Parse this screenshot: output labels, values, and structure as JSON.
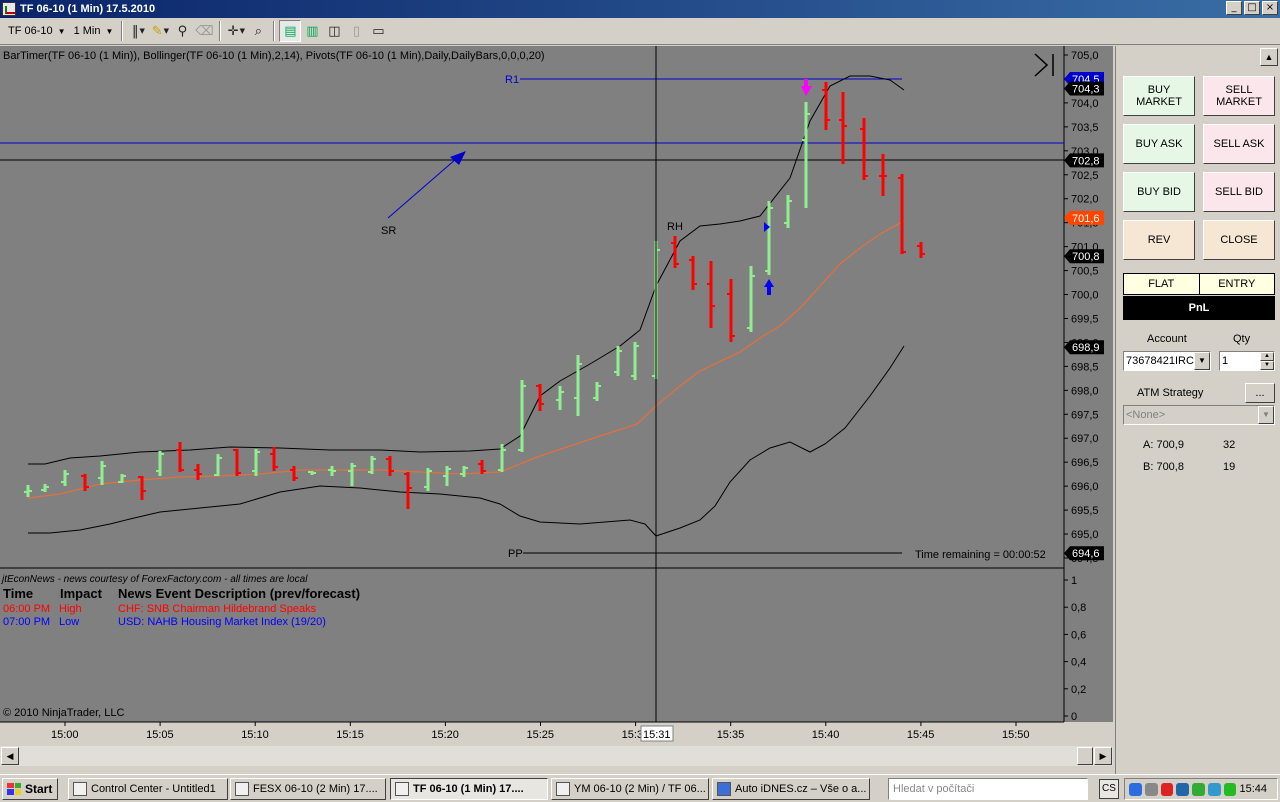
{
  "window": {
    "title": "TF 06-10 (1 Min)  17.5.2010",
    "buttons": [
      "_",
      "□",
      "×"
    ]
  },
  "toolbar": {
    "instrument": "TF 06-10",
    "interval": "1 Min"
  },
  "chart": {
    "indicators_label": "BarTimer(TF 06-10 (1 Min)), Bollinger(TF 06-10 (1 Min),2,14), Pivots(TF 06-10 (1 Min),Daily,DailyBars,0,0,0,20)",
    "labels": {
      "r1": "R1",
      "pp": "PP",
      "rh": "RH",
      "sr": "SR"
    },
    "time_remaining": "Time remaining = 00:00:52",
    "crosshair_time": "15:31",
    "price_axis": [
      "705,0",
      "704,5",
      "704,0",
      "703,5",
      "703,0",
      "702,5",
      "702,0",
      "701,5",
      "701,0",
      "700,5",
      "700,0",
      "699,5",
      "699,0",
      "698,5",
      "698,0",
      "697,5",
      "697,0",
      "696,5",
      "696,0",
      "695,5",
      "695,0",
      "694,5"
    ],
    "price_tags": [
      {
        "value": "704,5",
        "color": "#0000cc"
      },
      {
        "value": "704,3",
        "color": "#000000"
      },
      {
        "value": "702,8",
        "color": "#000000"
      },
      {
        "value": "701,6",
        "color": "#ff4500"
      },
      {
        "value": "700,8",
        "color": "#000000"
      },
      {
        "value": "698,9",
        "color": "#000000"
      },
      {
        "value": "694,6",
        "color": "#000000"
      }
    ],
    "indicator_axis": [
      "1",
      "0,8",
      "0,6",
      "0,4",
      "0,2",
      "0"
    ],
    "time_axis": [
      "15:00",
      "15:05",
      "15:10",
      "15:15",
      "15:20",
      "15:25",
      "15:30",
      "15:35",
      "15:40",
      "15:45",
      "15:50"
    ],
    "colors": {
      "up_bar": "#90ee90",
      "down_bar": "#ff0000",
      "bollinger": "#000000",
      "middle": "#ff4500",
      "pivot": "#0000cc",
      "background": "#808080"
    }
  },
  "news": {
    "credit": "jtEconNews - news courtesy of ForexFactory.com - all times are local",
    "headers": [
      "Time",
      "Impact",
      "News Event Description (prev/forecast)"
    ],
    "rows": [
      {
        "time": "06:00 PM",
        "impact": "High",
        "desc": "CHF: SNB Chairman Hildebrand Speaks",
        "color": "#ff0000"
      },
      {
        "time": "07:00 PM",
        "impact": "Low",
        "desc": "USD: NAHB Housing Market Index (19/20)",
        "color": "#0000ff"
      }
    ],
    "copyright": "© 2010 NinjaTrader, LLC"
  },
  "panel": {
    "buttons": {
      "buy_market": "BUY MARKET",
      "sell_market": "SELL MARKET",
      "buy_ask": "BUY ASK",
      "sell_ask": "SELL ASK",
      "buy_bid": "BUY BID",
      "sell_bid": "SELL BID",
      "rev": "REV",
      "close": "CLOSE"
    },
    "flat": "FLAT",
    "entry": "ENTRY",
    "pnl": "PnL",
    "account_label": "Account",
    "account_value": "73678421IRC",
    "qty_label": "Qty",
    "qty_value": "1",
    "atm_label": "ATM Strategy",
    "atm_button": "...",
    "atm_value": "<None>",
    "ask_label": "A: 700,9",
    "ask_size": "32",
    "bid_label": "B: 700,8",
    "bid_size": "19"
  },
  "taskbar": {
    "start": "Start",
    "items": [
      "Control Center - Untitled1",
      "FESX 06-10 (2 Min)  17....",
      "TF 06-10 (1 Min)  17....",
      "YM 06-10 (2 Min) / TF 06...",
      "Auto iDNES.cz – Vše o a..."
    ],
    "search_placeholder": "Hledat v počítači",
    "lang": "CS",
    "clock": "15:44"
  }
}
